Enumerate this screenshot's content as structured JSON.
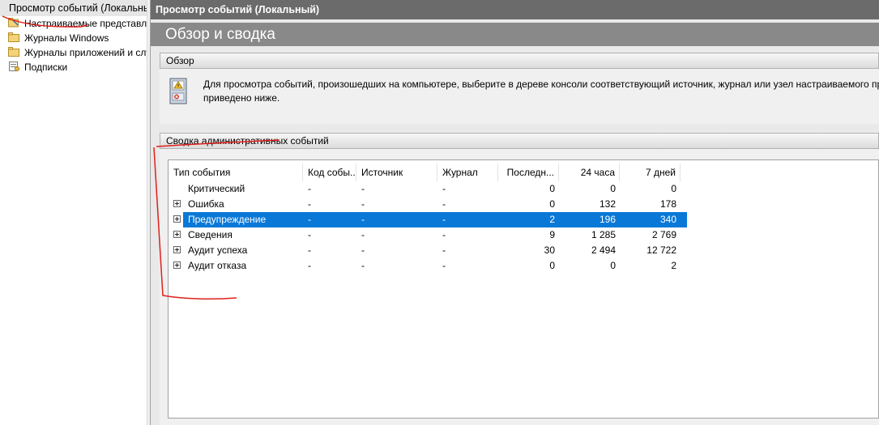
{
  "tree": {
    "root_label": "Просмотр событий (Локальный)",
    "items": [
      {
        "label": "Настраиваемые представления",
        "icon": "custom-views-icon"
      },
      {
        "label": "Журналы Windows",
        "icon": "folder-icon"
      },
      {
        "label": "Журналы приложений и служб",
        "icon": "folder-icon"
      },
      {
        "label": "Подписки",
        "icon": "subscriptions-icon"
      }
    ]
  },
  "right": {
    "title": "Просмотр событий (Локальный)",
    "overview_header": "Обзор и сводка",
    "section_overview": {
      "title": "Обзор",
      "text_line1": "Для просмотра событий, произошедших на компьютере, выберите в дереве консоли соответствующий источник, журнал или узел настраиваемого представления. Сводка административных событий",
      "text_line2": "приведено ниже."
    },
    "section_summary": {
      "title": "Сводка административных событий"
    }
  },
  "table": {
    "columns": [
      "Тип события",
      "Код собы...",
      "Источник",
      "Журнал",
      "Последн...",
      "24 часа",
      "7 дней"
    ],
    "rows": [
      {
        "type": "Критический",
        "code": "-",
        "source": "-",
        "log": "-",
        "last_hour": "0",
        "h24": "0",
        "d7": "0",
        "expandable": false,
        "selected": false
      },
      {
        "type": "Ошибка",
        "code": "-",
        "source": "-",
        "log": "-",
        "last_hour": "0",
        "h24": "132",
        "d7": "178",
        "expandable": true,
        "selected": false
      },
      {
        "type": "Предупреждение",
        "code": "-",
        "source": "-",
        "log": "-",
        "last_hour": "2",
        "h24": "196",
        "d7": "340",
        "expandable": true,
        "selected": true
      },
      {
        "type": "Сведения",
        "code": "-",
        "source": "-",
        "log": "-",
        "last_hour": "9",
        "h24": "1 285",
        "d7": "2 769",
        "expandable": true,
        "selected": false
      },
      {
        "type": "Аудит успеха",
        "code": "-",
        "source": "-",
        "log": "-",
        "last_hour": "30",
        "h24": "2 494",
        "d7": "12 722",
        "expandable": true,
        "selected": false
      },
      {
        "type": "Аудит отказа",
        "code": "-",
        "source": "-",
        "log": "-",
        "last_hour": "0",
        "h24": "0",
        "d7": "2",
        "expandable": true,
        "selected": false
      }
    ]
  },
  "colors": {
    "selection": "#0a78d7",
    "title_bar": "#6b6b6b",
    "overview_bar": "#898989",
    "annotation": "#e0201b"
  }
}
